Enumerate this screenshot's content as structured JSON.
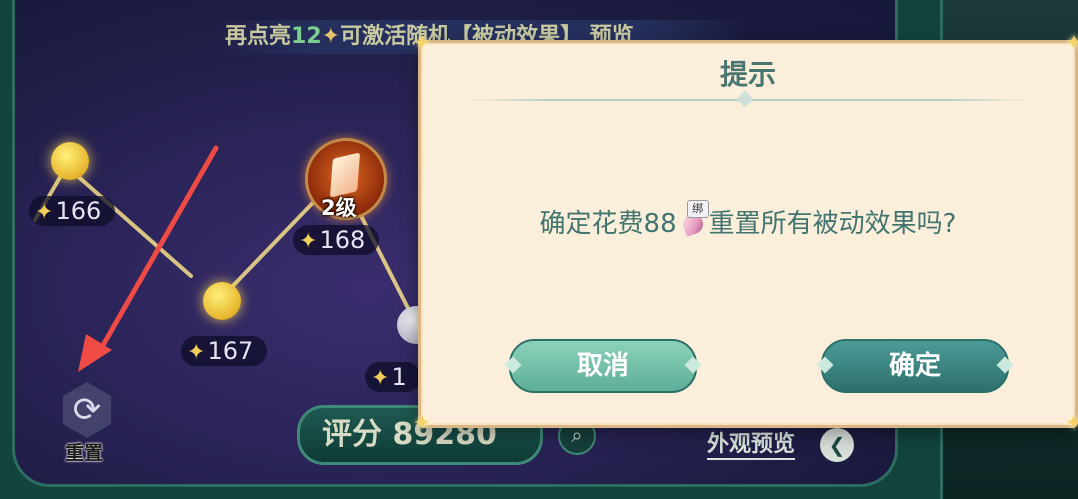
{
  "hint": {
    "prefix": "再点亮",
    "count": "12",
    "suffix": "可激活随机【被动效果】 预览"
  },
  "nodes": [
    {
      "cost": "166"
    },
    {
      "cost": "167"
    },
    {
      "cost": "168"
    },
    {
      "cost": "1"
    }
  ],
  "skill": {
    "level": "2级"
  },
  "score": {
    "label": "评分",
    "value": "89280"
  },
  "preview": {
    "label": "外观预览"
  },
  "reset": {
    "label": "重置"
  },
  "dialog": {
    "title": "提示",
    "message_before": "确定花费88",
    "bind_tag": "绑",
    "message_after": "重置所有被动效果吗?",
    "cancel_label": "取消",
    "confirm_label": "确定"
  },
  "colors": {
    "dialog_bg": "#fbefdc",
    "cancel_button": "#6fbfa7",
    "confirm_button": "#3d8783",
    "annotation_arrow": "#f04a45"
  }
}
